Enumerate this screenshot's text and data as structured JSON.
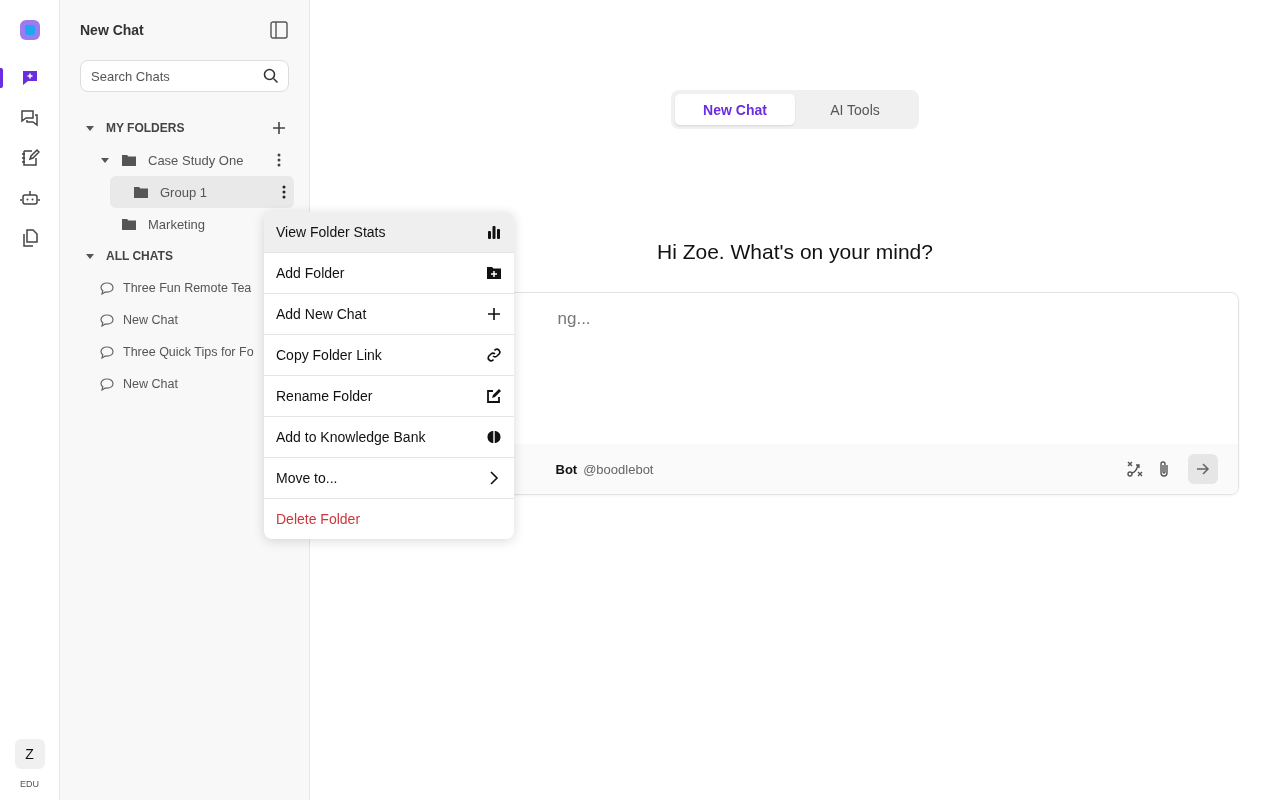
{
  "rail": {
    "items": [
      {
        "selected": true
      },
      {
        "selected": false
      },
      {
        "selected": false
      },
      {
        "selected": false
      },
      {
        "selected": false
      }
    ],
    "avatar": "Z",
    "plan": "EDU"
  },
  "sidebar": {
    "title": "New Chat",
    "search": {
      "placeholder": "Search Chats"
    },
    "folders_header": {
      "label": "MY FOLDERS",
      "expanded": true
    },
    "folders": [
      {
        "name": "Case Study One",
        "expanded": true,
        "selected": false,
        "children": [
          {
            "name": "Group 1",
            "selected": true
          }
        ]
      },
      {
        "name": "Marketing",
        "selected": false
      }
    ],
    "chats_header": {
      "label": "ALL CHATS",
      "expanded": true
    },
    "chats": [
      "Three Fun Remote Tea",
      "New Chat",
      "Three Quick Tips for Fo",
      "New Chat"
    ]
  },
  "tabs": [
    {
      "label": "New Chat",
      "selected": true
    },
    {
      "label": "AI Tools",
      "selected": false
    }
  ],
  "greeting": "Hi Zoe. What's on your mind?",
  "composer": {
    "placeholder": "ng...",
    "bot_name": "Bot",
    "bot_handle": "@boodlebot"
  },
  "context_menu": [
    {
      "label": "View Folder Stats",
      "kind": "normal",
      "highlighted": true
    },
    {
      "label": "Add Folder",
      "kind": "normal",
      "highlighted": false
    },
    {
      "label": "Add New Chat",
      "kind": "normal",
      "highlighted": false
    },
    {
      "label": "Copy Folder Link",
      "kind": "normal",
      "highlighted": false
    },
    {
      "label": "Rename Folder",
      "kind": "normal",
      "highlighted": false
    },
    {
      "label": "Add to Knowledge Bank",
      "kind": "normal",
      "highlighted": false
    },
    {
      "label": "Move to...",
      "kind": "normal",
      "highlighted": false
    },
    {
      "label": "Delete Folder",
      "kind": "danger",
      "highlighted": false
    }
  ]
}
